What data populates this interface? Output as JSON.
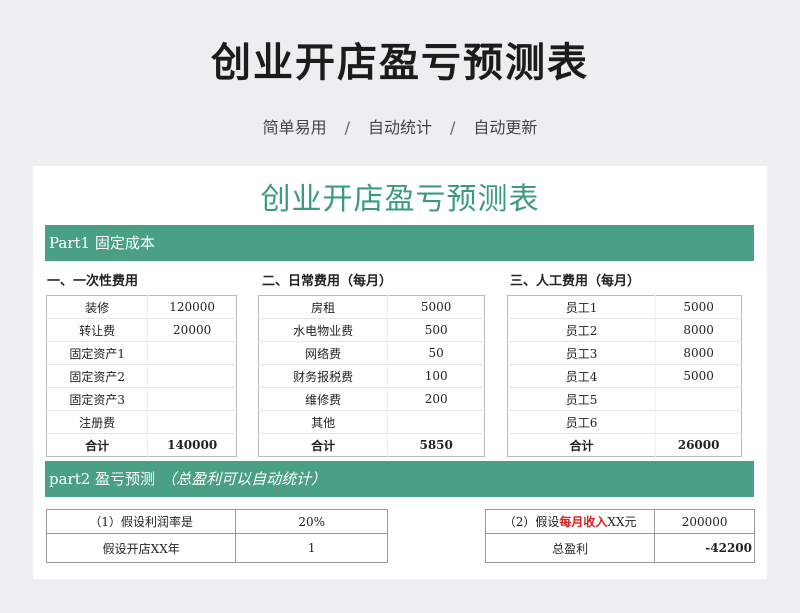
{
  "header": {
    "title": "创业开店盈亏预测表",
    "subtitle_items": [
      "简单易用",
      "自动统计",
      "自动更新"
    ],
    "separator": "/"
  },
  "sheet": {
    "title": "创业开店盈亏预测表",
    "part1_label": "Part1 固定成本",
    "part2_label": "part2 盈亏预测",
    "part2_note": "（总盈利可以自动统计）",
    "tables": [
      {
        "heading": "一、一次性费用",
        "rows": [
          {
            "name": "装修",
            "value": "120000"
          },
          {
            "name": "转让费",
            "value": "20000"
          },
          {
            "name": "固定资产1",
            "value": ""
          },
          {
            "name": "固定资产2",
            "value": ""
          },
          {
            "name": "固定资产3",
            "value": ""
          },
          {
            "name": "注册费",
            "value": ""
          },
          {
            "name": "合计",
            "value": "140000"
          }
        ]
      },
      {
        "heading": "二、日常费用（每月）",
        "rows": [
          {
            "name": "房租",
            "value": "5000"
          },
          {
            "name": "水电物业费",
            "value": "500"
          },
          {
            "name": "网络费",
            "value": "50"
          },
          {
            "name": "财务报税费",
            "value": "100"
          },
          {
            "name": "维修费",
            "value": "200"
          },
          {
            "name": "其他",
            "value": ""
          },
          {
            "name": "合计",
            "value": "5850"
          }
        ]
      },
      {
        "heading": "三、人工费用（每月）",
        "rows": [
          {
            "name": "员工1",
            "value": "5000"
          },
          {
            "name": "员工2",
            "value": "8000"
          },
          {
            "name": "员工3",
            "value": "8000"
          },
          {
            "name": "员工4",
            "value": "5000"
          },
          {
            "name": "员工5",
            "value": ""
          },
          {
            "name": "员工6",
            "value": ""
          },
          {
            "name": "合计",
            "value": "26000"
          }
        ]
      }
    ],
    "prediction": {
      "profit_rate_label": "（1）假设利润率是",
      "profit_rate_value": "20%",
      "years_label": "假设开店XX年",
      "years_value": "1",
      "income_label_prefix": "（2）假设",
      "income_label_highlight": "每月收入",
      "income_label_suffix": "XX元",
      "income_value": "200000",
      "total_label": "总盈利",
      "total_value": "-42200"
    },
    "accent_color": "#4aa084",
    "highlight_color": "#d62020"
  }
}
